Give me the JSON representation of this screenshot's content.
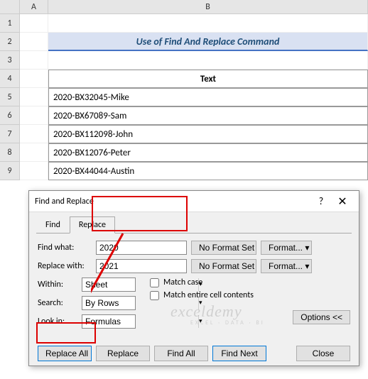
{
  "columns": {
    "A": "A",
    "B": "B"
  },
  "rows": [
    "1",
    "2",
    "3",
    "4",
    "5",
    "6",
    "7",
    "8",
    "9"
  ],
  "title": "Use of Find And Replace Command",
  "table": {
    "header": "Text",
    "data": [
      "2020-BX32045-Mike",
      "2020-BX67089-Sam",
      "2020-BX112098-John",
      "2020-BX12076-Peter",
      "2020-BX44044-Austin"
    ]
  },
  "dialog": {
    "title": "Find and Replace",
    "tabs": {
      "find": "Find",
      "replace": "Replace"
    },
    "labels": {
      "find_what": "Find what:",
      "replace_with": "Replace with:",
      "within": "Within:",
      "search": "Search:",
      "look_in": "Look in:"
    },
    "values": {
      "find_what": "2020",
      "replace_with": "2021",
      "within": "Sheet",
      "search": "By Rows",
      "look_in": "Formulas"
    },
    "no_format": "No Format Set",
    "format_btn": "Format...",
    "match_case": "Match case",
    "match_contents": "Match entire cell contents",
    "options_btn": "Options <<",
    "buttons": {
      "replace_all": "Replace All",
      "replace": "Replace",
      "find_all": "Find All",
      "find_next": "Find Next",
      "close": "Close"
    }
  },
  "watermark": "exceldemy",
  "watermark_sub": "EXCEL · DATA · BI"
}
